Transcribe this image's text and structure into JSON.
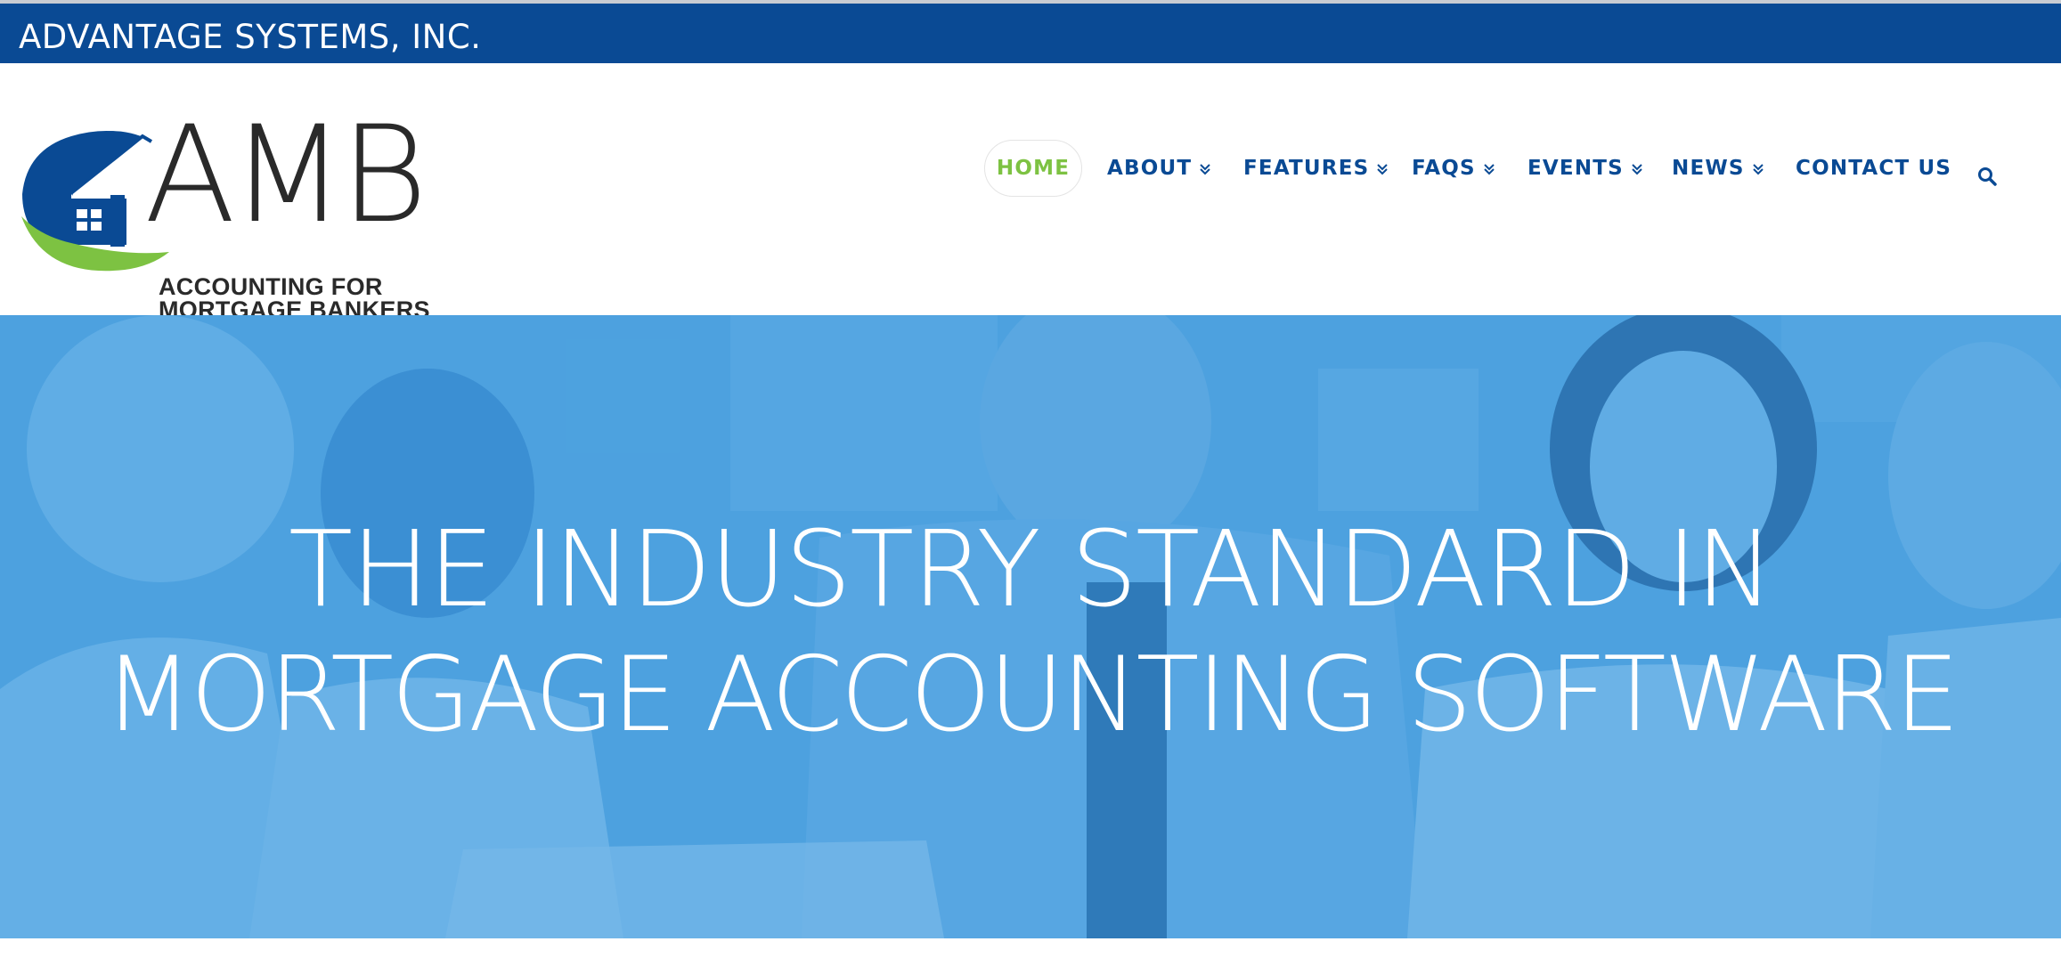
{
  "topbar": {
    "company_name": "ADVANTAGE SYSTEMS, INC."
  },
  "logo": {
    "wordmark": "AMB",
    "tagline_line1": "ACCOUNTING FOR",
    "tagline_line2": "MORTGAGE BANKERS"
  },
  "nav": {
    "items": [
      {
        "label": "HOME",
        "active": true,
        "has_dropdown": false
      },
      {
        "label": "ABOUT",
        "active": false,
        "has_dropdown": true
      },
      {
        "label": "FEATURES",
        "active": false,
        "has_dropdown": true
      },
      {
        "label": "FAQS",
        "active": false,
        "has_dropdown": true
      },
      {
        "label": "EVENTS",
        "active": false,
        "has_dropdown": true
      },
      {
        "label": "NEWS",
        "active": false,
        "has_dropdown": true
      },
      {
        "label": "CONTACT US",
        "active": false,
        "has_dropdown": false
      }
    ],
    "search_icon": "search-icon"
  },
  "hero": {
    "title_line1": "THE INDUSTRY STANDARD IN",
    "title_line2": "MORTGAGE ACCOUNTING SOFTWARE"
  },
  "colors": {
    "brand_blue": "#0a4a94",
    "accent_green": "#7dc242",
    "hero_blue": "#5aa8de"
  }
}
